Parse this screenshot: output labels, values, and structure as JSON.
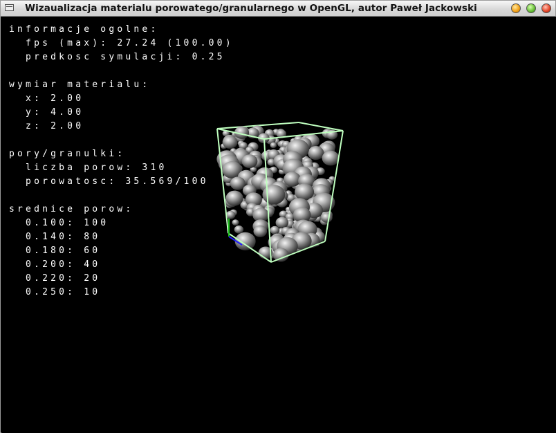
{
  "window": {
    "title": "Wizaualizacja materialu porowatego/granularnego w OpenGL, autor Paweł Jackowski",
    "buttons": [
      "minimize",
      "maximize",
      "close"
    ]
  },
  "info": {
    "general_heading": "informacje ogolne:",
    "fps_line": "  fps (max): 27.24 (100.00)",
    "speed_line": "  predkosc symulacji: 0.25",
    "dimension_heading": "wymiar materialu:",
    "dim_x": "  x: 2.00",
    "dim_y": "  y: 4.00",
    "dim_z": "  z: 2.00",
    "pores_heading": "pory/granulki:",
    "pore_count": "  liczba porow: 310",
    "porosity": "  porowatosc: 35.569/100",
    "diameters_heading": "srednice porow:",
    "diameters": [
      "  0.100: 100",
      "  0.140: 80",
      "  0.180: 60",
      "  0.200: 40",
      "  0.220: 20",
      "  0.250: 10"
    ]
  },
  "colors": {
    "box_edges": "#bfffbf",
    "sphere": "#8a8a8a",
    "axis_x": "#2020ff",
    "axis_y": "#20c020"
  }
}
